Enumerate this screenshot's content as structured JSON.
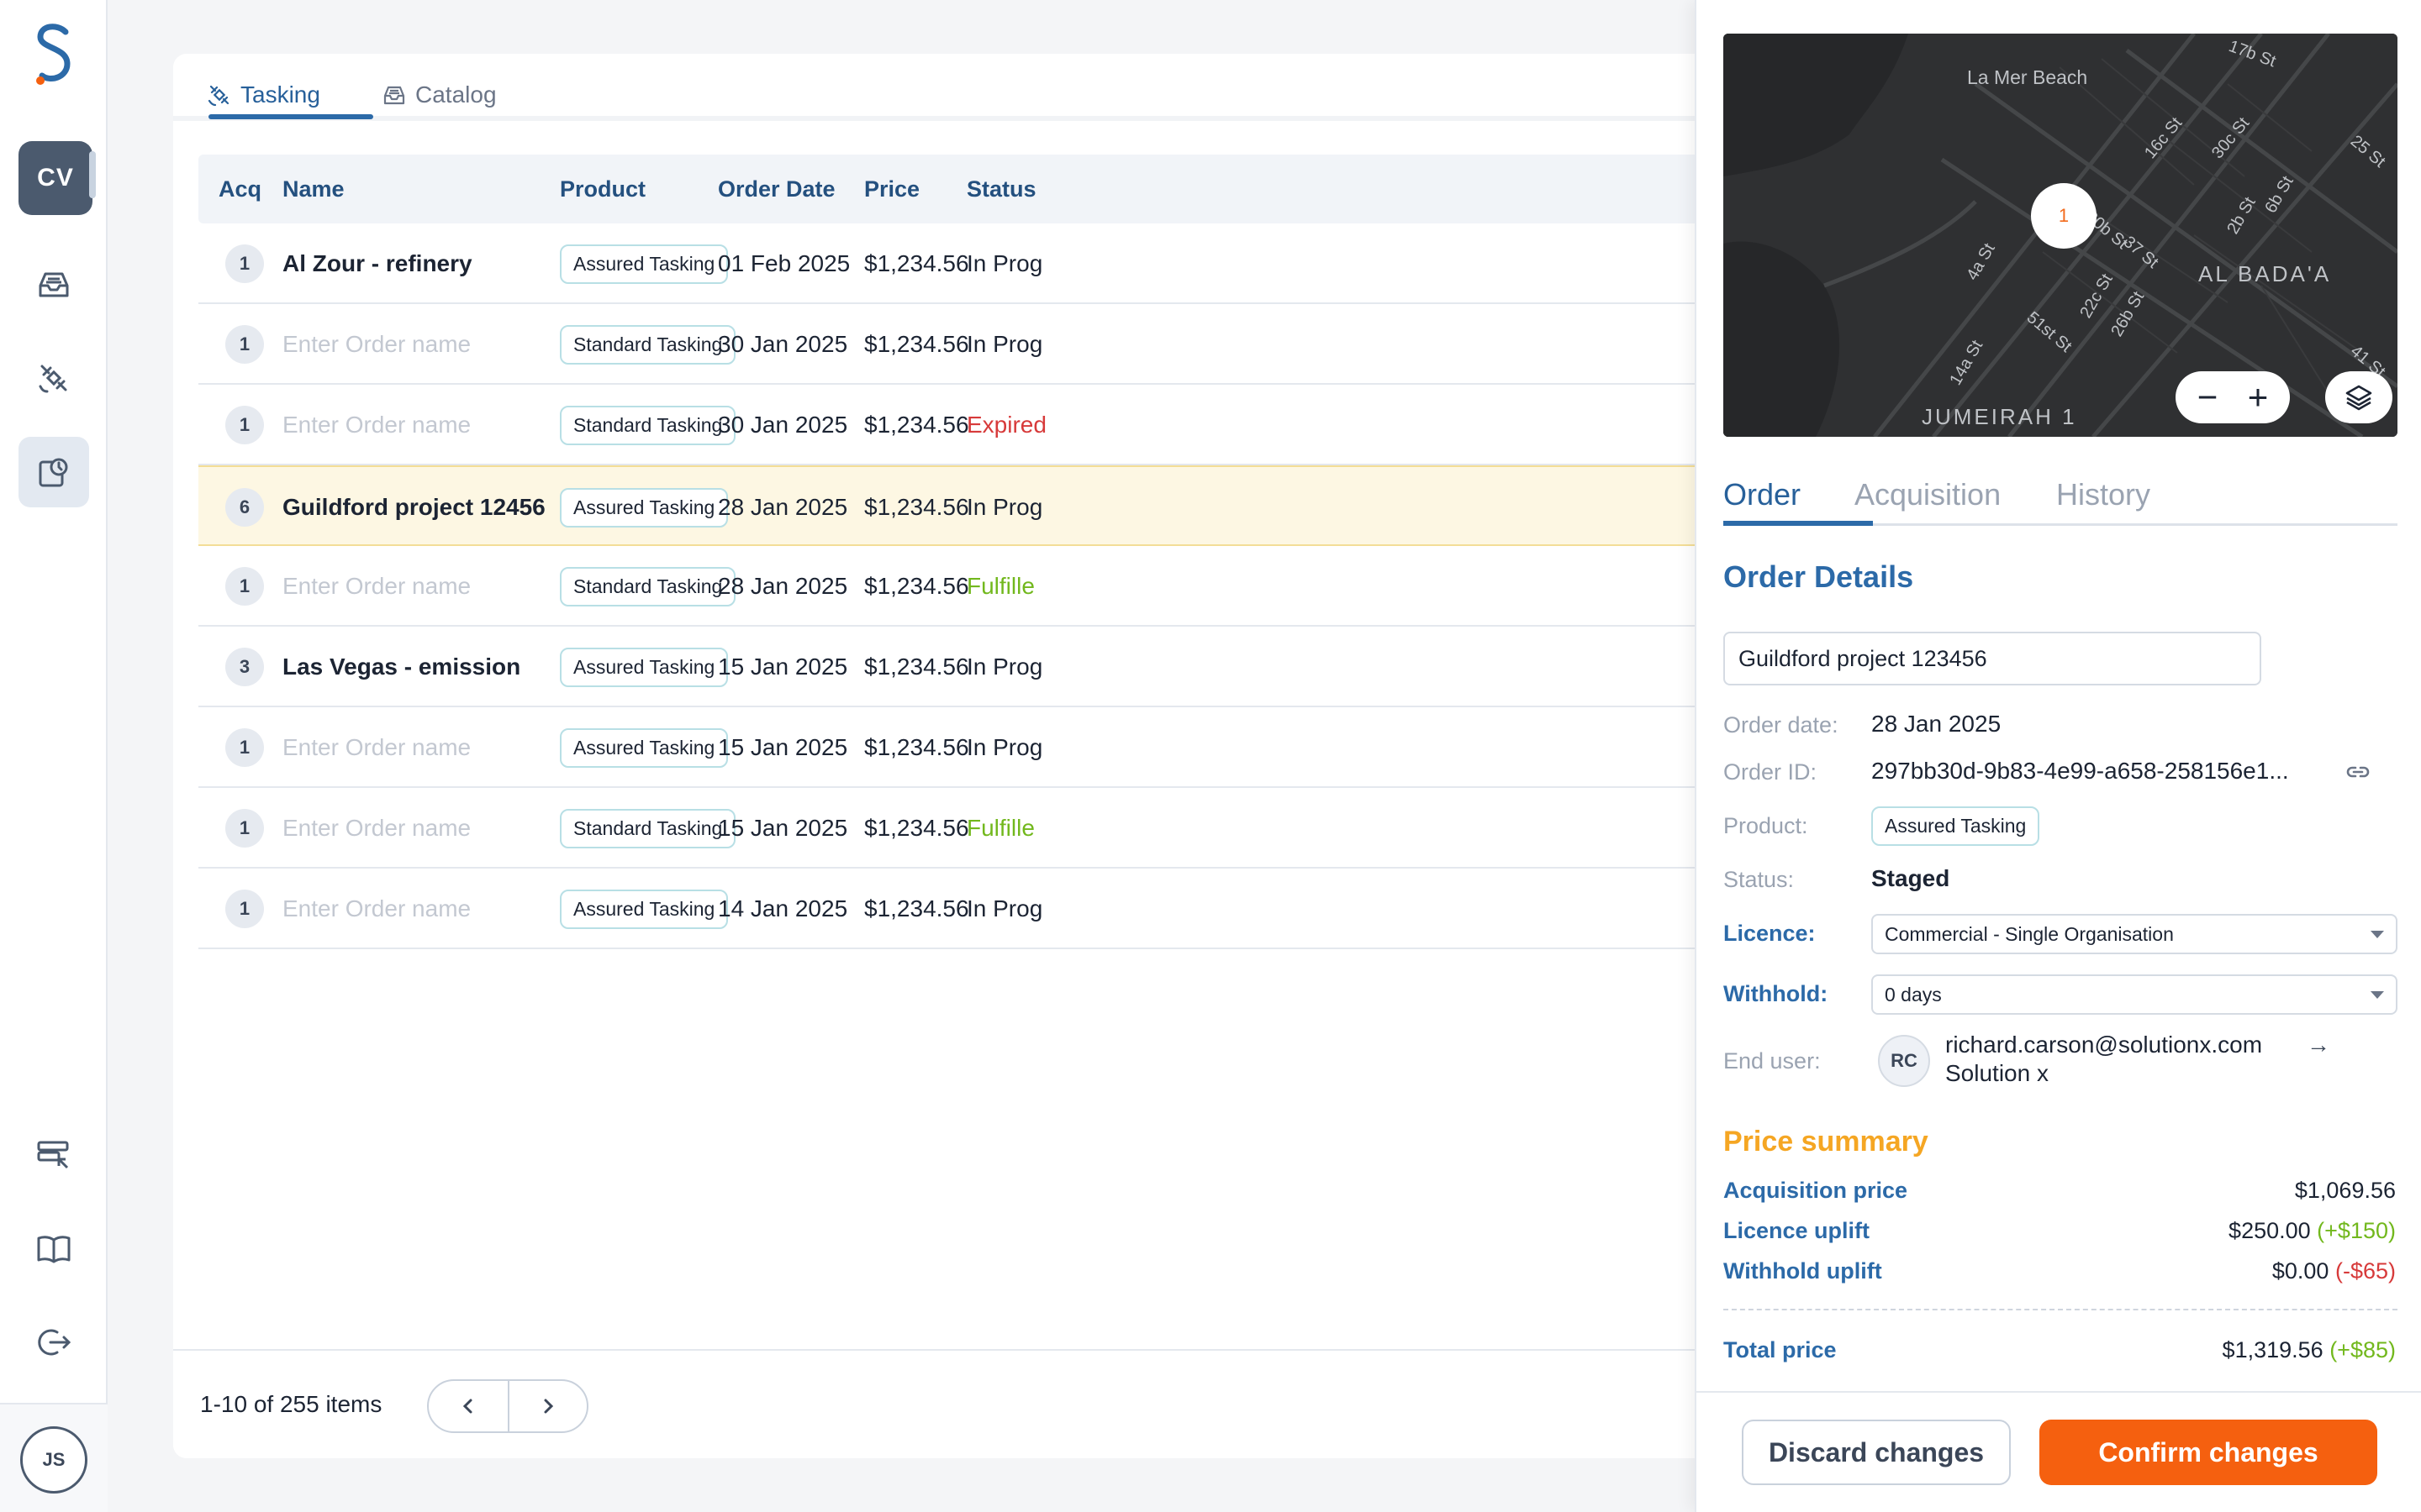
{
  "sidebar": {
    "cv_label": "CV",
    "user_initials": "JS",
    "icons": [
      "inbox-icon",
      "satellite-icon",
      "orders-clock-icon",
      "api-config-icon",
      "book-icon",
      "logout-icon"
    ]
  },
  "main": {
    "tabs": [
      {
        "label": "Tasking",
        "icon": "satellite-icon",
        "active": true
      },
      {
        "label": "Catalog",
        "icon": "inbox-icon",
        "active": false
      }
    ],
    "columns": {
      "acq": "Acq",
      "name": "Name",
      "product": "Product",
      "order_date": "Order Date",
      "price": "Price",
      "status": "Status"
    },
    "rows": [
      {
        "acq": "1",
        "name": "Al Zour - refinery",
        "name_placeholder": false,
        "product": "Assured Tasking",
        "date": "01 Feb 2025",
        "price": "$1,234.56",
        "status": "In Prog",
        "status_type": "inprog"
      },
      {
        "acq": "1",
        "name": "Enter Order name",
        "name_placeholder": true,
        "product": "Standard Tasking",
        "date": "30 Jan 2025",
        "price": "$1,234.56",
        "status": "In Prog",
        "status_type": "inprog"
      },
      {
        "acq": "1",
        "name": "Enter Order name",
        "name_placeholder": true,
        "product": "Standard Tasking",
        "date": "30 Jan 2025",
        "price": "$1,234.56",
        "status": "Expired",
        "status_type": "expired"
      },
      {
        "acq": "6",
        "name": "Guildford project 12456",
        "name_placeholder": false,
        "product": "Assured Tasking",
        "date": "28 Jan 2025",
        "price": "$1,234.56",
        "status": "In Prog",
        "status_type": "inprog",
        "highlight": true
      },
      {
        "acq": "1",
        "name": "Enter Order name",
        "name_placeholder": true,
        "product": "Standard Tasking",
        "date": "28 Jan 2025",
        "price": "$1,234.56",
        "status": "Fulfille",
        "status_type": "fulfilled"
      },
      {
        "acq": "3",
        "name": "Las Vegas - emission",
        "name_placeholder": false,
        "product": "Assured Tasking",
        "date": "15 Jan 2025",
        "price": "$1,234.56",
        "status": "In Prog",
        "status_type": "inprog"
      },
      {
        "acq": "1",
        "name": "Enter Order name",
        "name_placeholder": true,
        "product": "Assured Tasking",
        "date": "15 Jan 2025",
        "price": "$1,234.56",
        "status": "In Prog",
        "status_type": "inprog"
      },
      {
        "acq": "1",
        "name": "Enter Order name",
        "name_placeholder": true,
        "product": "Standard Tasking",
        "date": "15 Jan 2025",
        "price": "$1,234.56",
        "status": "Fulfille",
        "status_type": "fulfilled"
      },
      {
        "acq": "1",
        "name": "Enter Order name",
        "name_placeholder": true,
        "product": "Assured Tasking",
        "date": "14 Jan 2025",
        "price": "$1,234.56",
        "status": "In Prog",
        "status_type": "inprog"
      }
    ],
    "pagination": {
      "summary": "1-10 of 255 items"
    }
  },
  "detail": {
    "map": {
      "labels": [
        "La Mer Beach",
        "AL BADA'A",
        "JUMEIRAH 1",
        "16c St",
        "30c St",
        "25 St",
        "20b St",
        "37 St",
        "2b St",
        "6b St",
        "4a St",
        "22c St",
        "26b St",
        "51st St",
        "14a St",
        "41 St",
        "17b St"
      ],
      "marker_count": "1"
    },
    "tabs": [
      "Order",
      "Acquisition",
      "History"
    ],
    "active_tab": "Order",
    "section_title": "Order Details",
    "order_name_value": "Guildford project 123456",
    "fields": {
      "order_date_label": "Order date:",
      "order_date": "28 Jan 2025",
      "order_id_label": "Order ID:",
      "order_id": "297bb30d-9b83-4e99-a658-258156e1...",
      "product_label": "Product:",
      "product": "Assured Tasking",
      "status_label": "Status:",
      "status": "Staged",
      "licence_label": "Licence:",
      "licence": "Commercial - Single Organisation",
      "withhold_label": "Withhold:",
      "withhold": "0 days",
      "end_user_label": "End user:",
      "end_user_initials": "RC",
      "end_user_email": "richard.carson@solutionx.com",
      "end_user_org": "Solution x"
    },
    "price_summary": {
      "title": "Price summary",
      "acq_label": "Acquisition price",
      "acq_value": "$1,069.56",
      "licence_label": "Licence uplift",
      "licence_value": "$250.00",
      "licence_delta": "(+$150)",
      "withhold_label": "Withhold uplift",
      "withhold_value": "$0.00",
      "withhold_delta": "(-$65)",
      "total_label": "Total price",
      "total_value": "$1,319.56",
      "total_delta": "(+$85)"
    },
    "buttons": {
      "discard": "Discard changes",
      "confirm": "Confirm changes"
    },
    "colors": {
      "accent": "#2c6aa8",
      "confirm": "#f5600f",
      "price_title": "#f5a623",
      "positive": "#72b81d",
      "negative": "#d73a3a"
    }
  }
}
